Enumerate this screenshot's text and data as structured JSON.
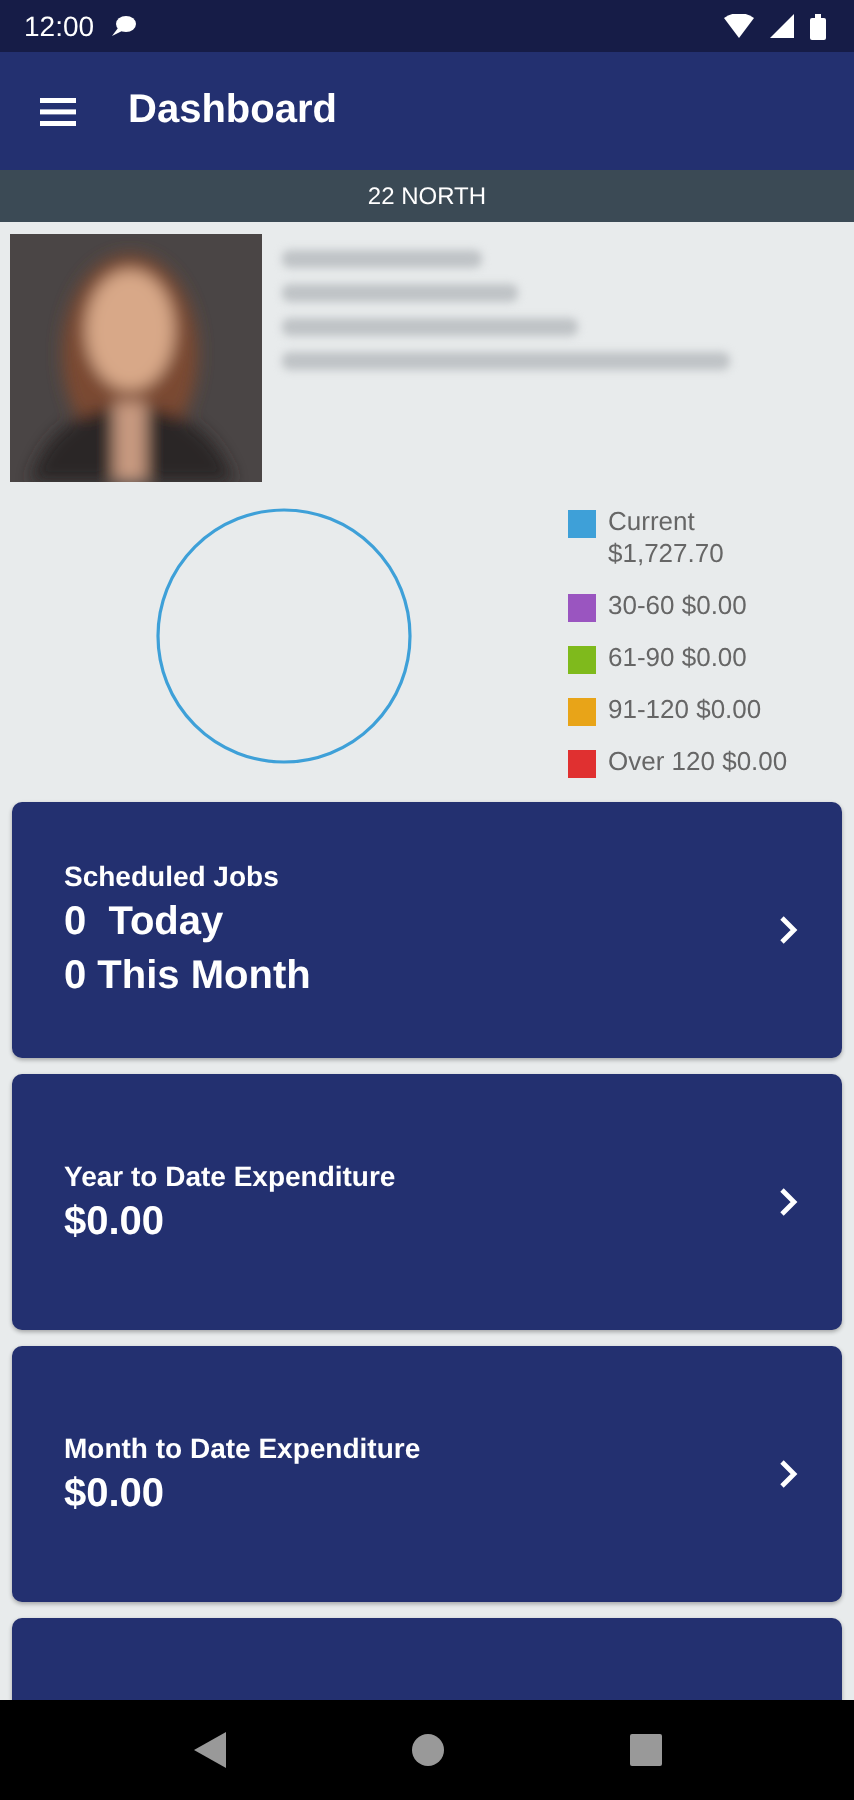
{
  "status_bar": {
    "time": "12:00"
  },
  "app_bar": {
    "title": "Dashboard"
  },
  "location": "22 NORTH",
  "legend": [
    {
      "label": "Current\n$1,727.70",
      "color": "#3ea0d8"
    },
    {
      "label": "30-60 $0.00",
      "color": "#9a55c0"
    },
    {
      "label": "61-90 $0.00",
      "color": "#7fba1c"
    },
    {
      "label": "91-120 $0.00",
      "color": "#e8a418"
    },
    {
      "label": "Over 120 $0.00",
      "color": "#e03030"
    }
  ],
  "cards": [
    {
      "kind": "full",
      "label": "Scheduled Jobs",
      "values": [
        "0  Today",
        "0 This Month"
      ]
    },
    {
      "kind": "full",
      "label": "Year to Date Expenditure",
      "values": [
        "$0.00"
      ]
    },
    {
      "kind": "full",
      "label": "Month to Date Expenditure",
      "values": [
        "$0.00"
      ]
    },
    {
      "kind": "cut"
    }
  ]
}
